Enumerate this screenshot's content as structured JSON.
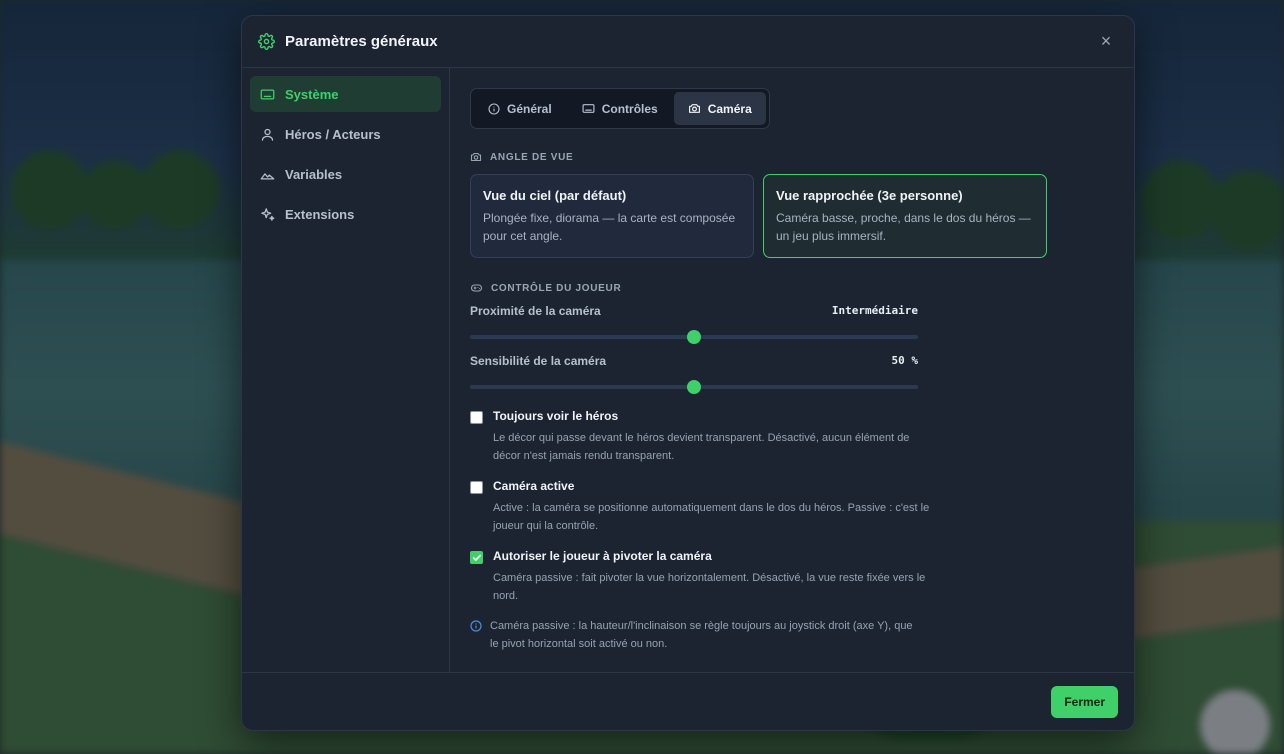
{
  "dialog": {
    "title": "Paramètres généraux",
    "close_icon": "×",
    "accent": "#3fd06a"
  },
  "sidebar": {
    "items": [
      {
        "label": "Système",
        "icon": "keyboard-icon",
        "active": true
      },
      {
        "label": "Héros / Acteurs",
        "icon": "user-icon",
        "active": false
      },
      {
        "label": "Variables",
        "icon": "mountain-icon",
        "active": false
      },
      {
        "label": "Extensions",
        "icon": "sparkles-icon",
        "active": false
      }
    ]
  },
  "tabs": [
    {
      "label": "Général",
      "icon": "info-icon",
      "active": false
    },
    {
      "label": "Contrôles",
      "icon": "keyboard-icon",
      "active": false
    },
    {
      "label": "Caméra",
      "icon": "camera-icon",
      "active": true
    }
  ],
  "view_angle": {
    "label": "Angle de vue",
    "cards": [
      {
        "title": "Vue du ciel (par défaut)",
        "desc": "Plongée fixe, diorama — la carte est composée pour cet angle.",
        "selected": false
      },
      {
        "title": "Vue rapprochée (3e personne)",
        "desc": "Caméra basse, proche, dans le dos du héros — un jeu plus immersif.",
        "selected": true
      }
    ]
  },
  "player_control": {
    "label": "Contrôle du joueur",
    "sliders": [
      {
        "label": "Proximité de la caméra",
        "value_text": "Intermédiaire",
        "fraction": 0.5
      },
      {
        "label": "Sensibilité de la caméra",
        "value_text": "50 %",
        "fraction": 0.5
      }
    ],
    "checkboxes": [
      {
        "title": "Toujours voir le héros",
        "desc": "Le décor qui passe devant le héros devient transparent. Désactivé, aucun élément de décor n'est jamais rendu transparent.",
        "checked": false
      },
      {
        "title": "Caméra active",
        "desc": "Active : la caméra se positionne automatiquement dans le dos du héros. Passive : c'est le joueur qui la contrôle.",
        "checked": false
      },
      {
        "title": "Autoriser le joueur à pivoter la caméra",
        "desc": "Caméra passive : fait pivoter la vue horizontalement. Désactivé, la vue reste fixée vers le nord.",
        "checked": true
      }
    ],
    "info": "Caméra passive : la hauteur/l'inclinaison se règle toujours au joystick droit (axe Y), que le pivot horizontal soit activé ou non."
  },
  "footer": {
    "close_label": "Fermer"
  }
}
